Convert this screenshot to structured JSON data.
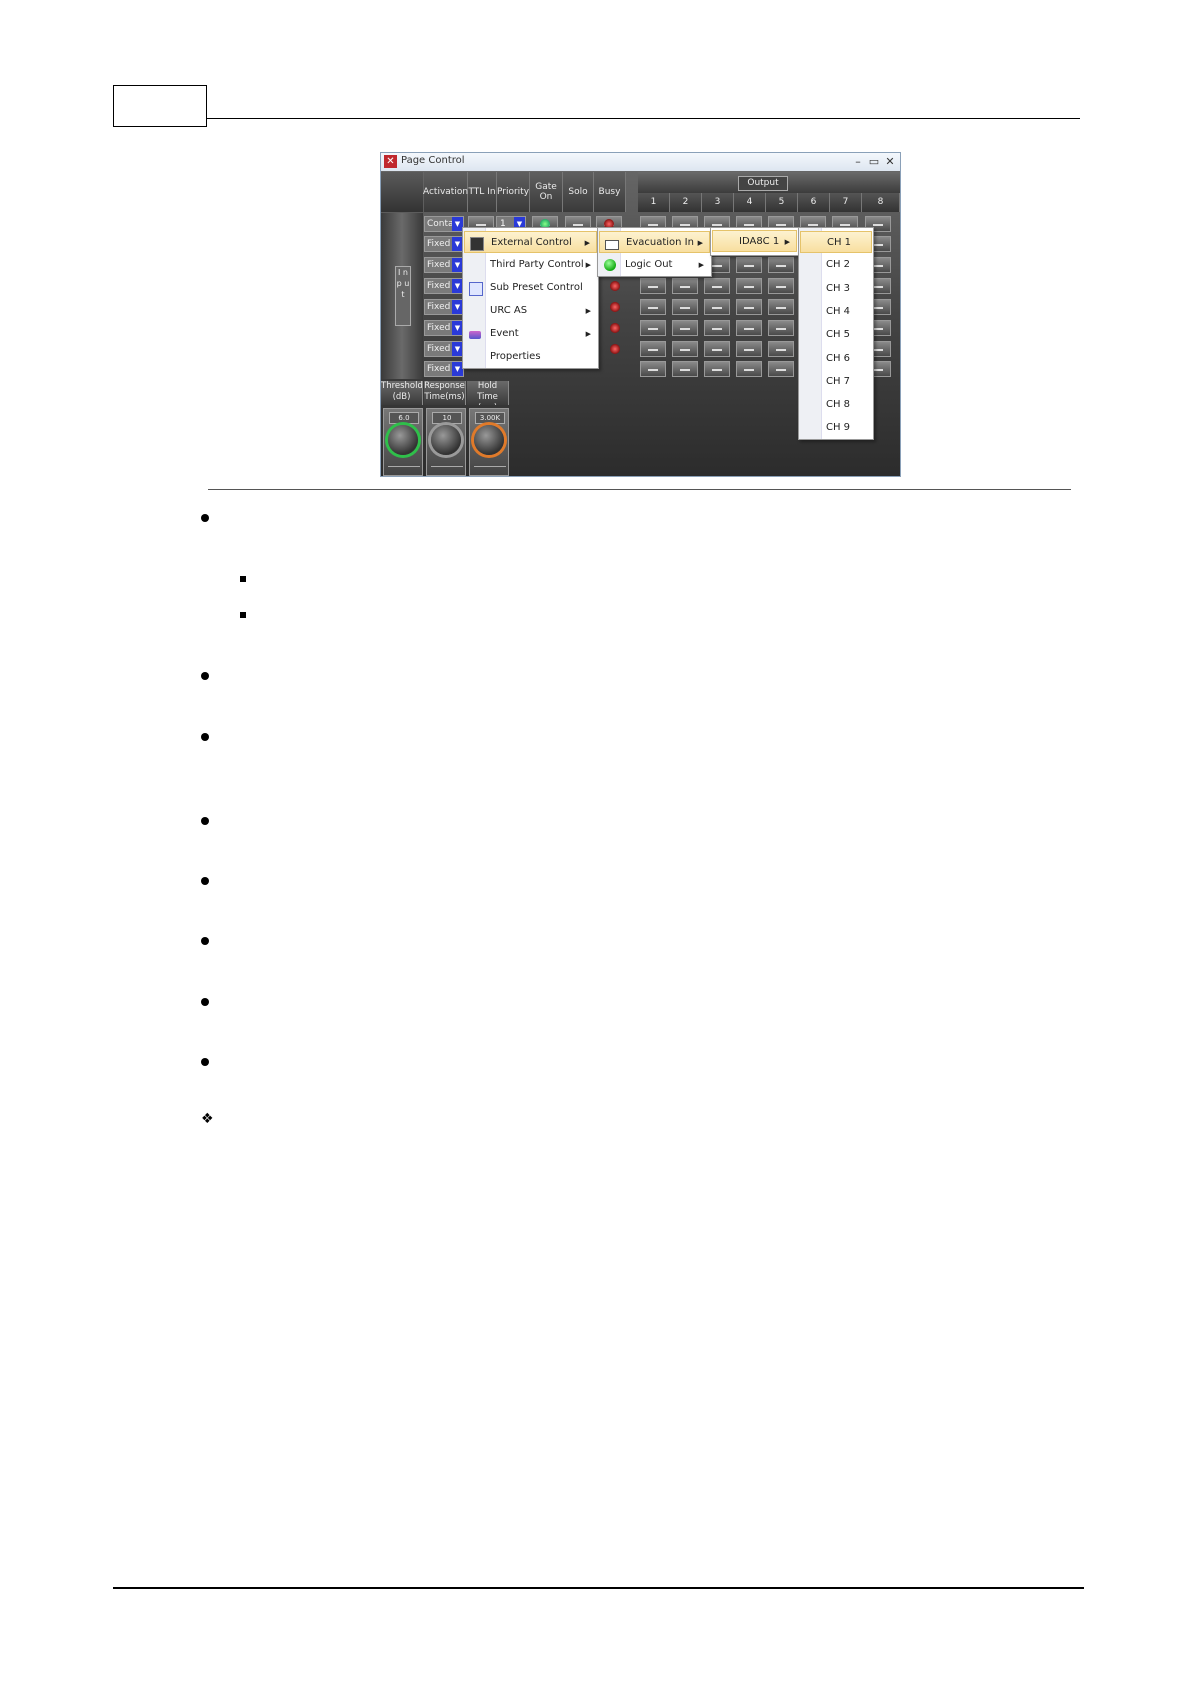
{
  "window": {
    "title": "Page Control",
    "controls": [
      "–",
      "▭",
      "✕"
    ],
    "column_headers": [
      "Activation",
      "TTL In",
      "Priority",
      "Gate On",
      "Solo",
      "Busy"
    ],
    "output_label": "Output",
    "output_channels": [
      "1",
      "2",
      "3",
      "4",
      "5",
      "6",
      "7",
      "8"
    ],
    "input_label": "I n p u t",
    "activation_values": [
      "Conta",
      "Fixed",
      "Fixed",
      "Fixed",
      "Fixed",
      "Fixed",
      "Fixed",
      "Fixed"
    ],
    "priority_value": "1",
    "knob_headers": [
      "Threshold (dB)",
      "Response Time(ms)",
      "Hold Time (ms)"
    ],
    "knob_values": [
      "6.0",
      "10",
      "3.00K"
    ],
    "knob_colors": [
      "#2fbf4a",
      "#9a9a9a",
      "#e07a2a"
    ]
  },
  "menu1": {
    "items": [
      {
        "label": "External Control",
        "icon": "external-control-icon",
        "submenu": true,
        "highlighted": true
      },
      {
        "label": "Third Party Control",
        "icon": "",
        "submenu": true
      },
      {
        "label": "Sub Preset Control",
        "icon": "sub-preset-icon",
        "submenu": false
      },
      {
        "label": "URC AS",
        "icon": "",
        "submenu": true
      },
      {
        "label": "Event",
        "icon": "event-icon",
        "submenu": true
      },
      {
        "label": "Properties",
        "icon": "",
        "submenu": false
      }
    ]
  },
  "menu2": {
    "items": [
      {
        "label": "Evacuation In",
        "icon": "evacuation-icon",
        "submenu": true,
        "highlighted": true
      },
      {
        "label": "Logic Out",
        "icon": "green-led-icon",
        "submenu": true
      }
    ]
  },
  "menu3": {
    "items": [
      {
        "label": "IDA8C 1",
        "submenu": true,
        "highlighted": true
      }
    ]
  },
  "menu4": {
    "items": [
      "CH 1",
      "CH 2",
      "CH 3",
      "CH 4",
      "CH 5",
      "CH 6",
      "CH 7",
      "CH 8",
      "CH 9"
    ]
  }
}
